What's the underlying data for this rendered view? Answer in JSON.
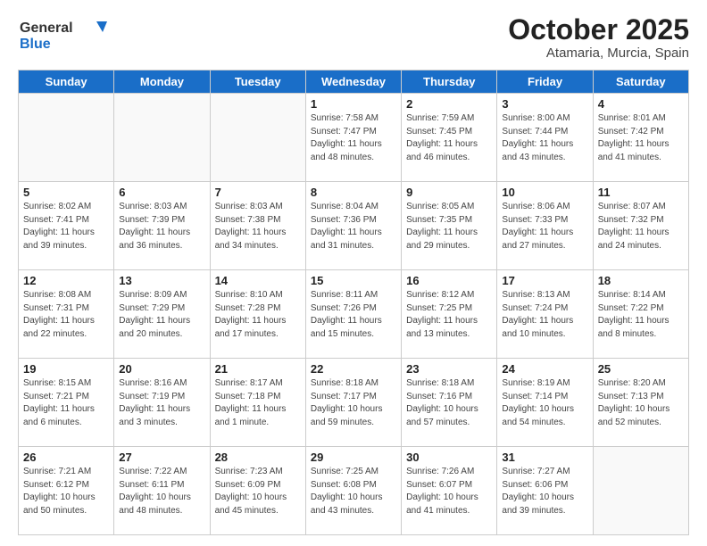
{
  "header": {
    "logo_general": "General",
    "logo_blue": "Blue",
    "title": "October 2025",
    "location": "Atamaria, Murcia, Spain"
  },
  "days_of_week": [
    "Sunday",
    "Monday",
    "Tuesday",
    "Wednesday",
    "Thursday",
    "Friday",
    "Saturday"
  ],
  "weeks": [
    [
      {
        "day": "",
        "info": ""
      },
      {
        "day": "",
        "info": ""
      },
      {
        "day": "",
        "info": ""
      },
      {
        "day": "1",
        "info": "Sunrise: 7:58 AM\nSunset: 7:47 PM\nDaylight: 11 hours\nand 48 minutes."
      },
      {
        "day": "2",
        "info": "Sunrise: 7:59 AM\nSunset: 7:45 PM\nDaylight: 11 hours\nand 46 minutes."
      },
      {
        "day": "3",
        "info": "Sunrise: 8:00 AM\nSunset: 7:44 PM\nDaylight: 11 hours\nand 43 minutes."
      },
      {
        "day": "4",
        "info": "Sunrise: 8:01 AM\nSunset: 7:42 PM\nDaylight: 11 hours\nand 41 minutes."
      }
    ],
    [
      {
        "day": "5",
        "info": "Sunrise: 8:02 AM\nSunset: 7:41 PM\nDaylight: 11 hours\nand 39 minutes."
      },
      {
        "day": "6",
        "info": "Sunrise: 8:03 AM\nSunset: 7:39 PM\nDaylight: 11 hours\nand 36 minutes."
      },
      {
        "day": "7",
        "info": "Sunrise: 8:03 AM\nSunset: 7:38 PM\nDaylight: 11 hours\nand 34 minutes."
      },
      {
        "day": "8",
        "info": "Sunrise: 8:04 AM\nSunset: 7:36 PM\nDaylight: 11 hours\nand 31 minutes."
      },
      {
        "day": "9",
        "info": "Sunrise: 8:05 AM\nSunset: 7:35 PM\nDaylight: 11 hours\nand 29 minutes."
      },
      {
        "day": "10",
        "info": "Sunrise: 8:06 AM\nSunset: 7:33 PM\nDaylight: 11 hours\nand 27 minutes."
      },
      {
        "day": "11",
        "info": "Sunrise: 8:07 AM\nSunset: 7:32 PM\nDaylight: 11 hours\nand 24 minutes."
      }
    ],
    [
      {
        "day": "12",
        "info": "Sunrise: 8:08 AM\nSunset: 7:31 PM\nDaylight: 11 hours\nand 22 minutes."
      },
      {
        "day": "13",
        "info": "Sunrise: 8:09 AM\nSunset: 7:29 PM\nDaylight: 11 hours\nand 20 minutes."
      },
      {
        "day": "14",
        "info": "Sunrise: 8:10 AM\nSunset: 7:28 PM\nDaylight: 11 hours\nand 17 minutes."
      },
      {
        "day": "15",
        "info": "Sunrise: 8:11 AM\nSunset: 7:26 PM\nDaylight: 11 hours\nand 15 minutes."
      },
      {
        "day": "16",
        "info": "Sunrise: 8:12 AM\nSunset: 7:25 PM\nDaylight: 11 hours\nand 13 minutes."
      },
      {
        "day": "17",
        "info": "Sunrise: 8:13 AM\nSunset: 7:24 PM\nDaylight: 11 hours\nand 10 minutes."
      },
      {
        "day": "18",
        "info": "Sunrise: 8:14 AM\nSunset: 7:22 PM\nDaylight: 11 hours\nand 8 minutes."
      }
    ],
    [
      {
        "day": "19",
        "info": "Sunrise: 8:15 AM\nSunset: 7:21 PM\nDaylight: 11 hours\nand 6 minutes."
      },
      {
        "day": "20",
        "info": "Sunrise: 8:16 AM\nSunset: 7:19 PM\nDaylight: 11 hours\nand 3 minutes."
      },
      {
        "day": "21",
        "info": "Sunrise: 8:17 AM\nSunset: 7:18 PM\nDaylight: 11 hours\nand 1 minute."
      },
      {
        "day": "22",
        "info": "Sunrise: 8:18 AM\nSunset: 7:17 PM\nDaylight: 10 hours\nand 59 minutes."
      },
      {
        "day": "23",
        "info": "Sunrise: 8:18 AM\nSunset: 7:16 PM\nDaylight: 10 hours\nand 57 minutes."
      },
      {
        "day": "24",
        "info": "Sunrise: 8:19 AM\nSunset: 7:14 PM\nDaylight: 10 hours\nand 54 minutes."
      },
      {
        "day": "25",
        "info": "Sunrise: 8:20 AM\nSunset: 7:13 PM\nDaylight: 10 hours\nand 52 minutes."
      }
    ],
    [
      {
        "day": "26",
        "info": "Sunrise: 7:21 AM\nSunset: 6:12 PM\nDaylight: 10 hours\nand 50 minutes."
      },
      {
        "day": "27",
        "info": "Sunrise: 7:22 AM\nSunset: 6:11 PM\nDaylight: 10 hours\nand 48 minutes."
      },
      {
        "day": "28",
        "info": "Sunrise: 7:23 AM\nSunset: 6:09 PM\nDaylight: 10 hours\nand 45 minutes."
      },
      {
        "day": "29",
        "info": "Sunrise: 7:25 AM\nSunset: 6:08 PM\nDaylight: 10 hours\nand 43 minutes."
      },
      {
        "day": "30",
        "info": "Sunrise: 7:26 AM\nSunset: 6:07 PM\nDaylight: 10 hours\nand 41 minutes."
      },
      {
        "day": "31",
        "info": "Sunrise: 7:27 AM\nSunset: 6:06 PM\nDaylight: 10 hours\nand 39 minutes."
      },
      {
        "day": "",
        "info": ""
      }
    ]
  ]
}
